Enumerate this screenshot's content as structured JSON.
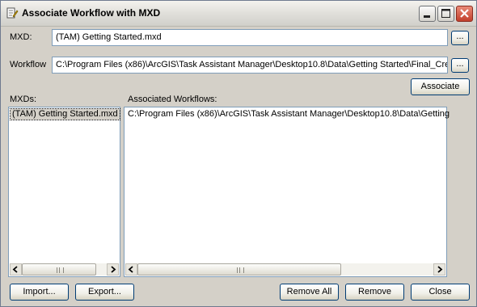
{
  "window": {
    "title": "Associate Workflow with MXD",
    "icons": {
      "app": "document-tool-icon",
      "minimize": "minimize-icon",
      "maximize": "maximize-icon",
      "close": "close-icon"
    }
  },
  "form": {
    "mxd_label": "MXD:",
    "mxd_value": "(TAM) Getting Started.mxd",
    "browse_label": "...",
    "workflow_label": "Workflow",
    "workflow_value": "C:\\Program Files (x86)\\ArcGIS\\Task Assistant Manager\\Desktop10.8\\Data\\Getting Started\\Final_Cre",
    "associate_label": "Associate"
  },
  "lists": {
    "mxds_label": "MXDs:",
    "mxds_items": [
      "(TAM) Getting Started.mxd"
    ],
    "workflows_label": "Associated Workflows:",
    "workflows_items": [
      "C:\\Program Files (x86)\\ArcGIS\\Task Assistant Manager\\Desktop10.8\\Data\\Getting"
    ]
  },
  "buttons": {
    "import": "Import...",
    "export": "Export...",
    "remove_all": "Remove All",
    "remove": "Remove",
    "close": "Close"
  },
  "colors": {
    "dialog_bg": "#d4d0c8",
    "field_border": "#7f9db9",
    "button_border": "#003c74",
    "close_button": "#c2402c"
  }
}
